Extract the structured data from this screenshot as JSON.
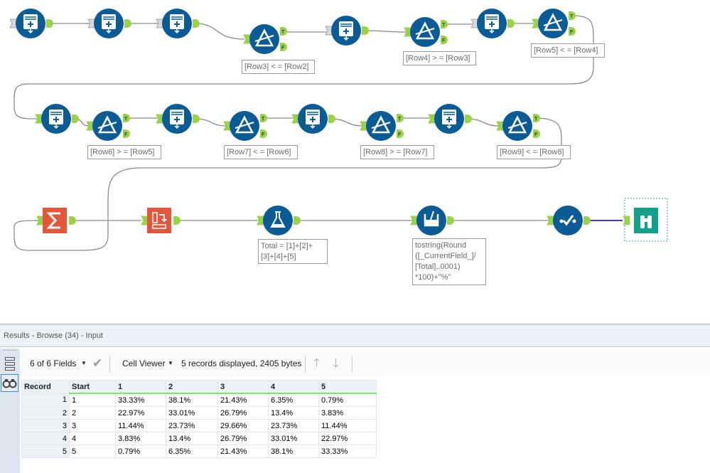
{
  "workflow": {
    "annotations": {
      "f1": "[Row3] < = [Row2]",
      "f2": "[Row4] > = [Row3]",
      "f3": "[Row5] < = [Row4]",
      "f4": "[Row6] > = [Row5]",
      "f5": "[Row7] < = [Row6]",
      "f6": "[Row8] > = [Row7]",
      "f7": "[Row9] < = [Row8]",
      "formula": "Total = [1]+[2]+\n[3]+[4]+[5]",
      "multifield": "tostring(Round\n([_CurrentField_]/\n[Total],.0001)\n*100)+\"%\""
    },
    "port_labels": {
      "true": "T",
      "false": "F"
    },
    "colors": {
      "tool_blue": "#0b5c96",
      "tool_orange": "#e2573b",
      "browse_green": "#13a088",
      "port_green": "#9bd24a",
      "wire": "#8a8a8a",
      "selected_wire": "#3b3bdc"
    }
  },
  "results": {
    "title": "Results - Browse (34) - Input",
    "fields_selector": "6 of 6 Fields",
    "viewer_selector": "Cell Viewer",
    "status": "5 records displayed, 2405 bytes",
    "columns": [
      "Record",
      "Start",
      "1",
      "2",
      "3",
      "4",
      "5"
    ],
    "rows": [
      [
        "1",
        "1",
        "33.33%",
        "38.1%",
        "21.43%",
        "6.35%",
        "0.79%"
      ],
      [
        "2",
        "2",
        "22.97%",
        "33.01%",
        "26.79%",
        "13.4%",
        "3.83%"
      ],
      [
        "3",
        "3",
        "11.44%",
        "23.73%",
        "29.66%",
        "23.73%",
        "11.44%"
      ],
      [
        "4",
        "4",
        "3.83%",
        "13.4%",
        "26.79%",
        "33.01%",
        "22.97%"
      ],
      [
        "5",
        "5",
        "0.79%",
        "6.35%",
        "21.43%",
        "38.1%",
        "33.33%"
      ]
    ]
  }
}
